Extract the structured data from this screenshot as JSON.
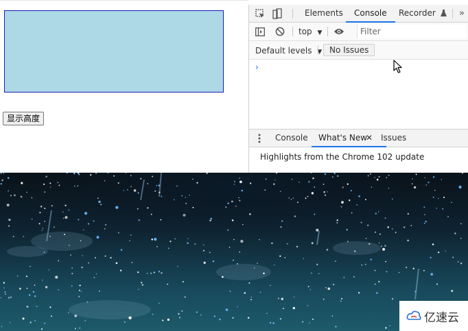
{
  "page": {
    "button_label": "显示高度"
  },
  "devtools": {
    "tabs": [
      "Elements",
      "Console",
      "Recorder"
    ],
    "active_tab": "Console",
    "more_tabs": "»",
    "console_toolbar": {
      "context": "top",
      "filter_placeholder": "Filter"
    },
    "levels": {
      "label": "Default levels",
      "issues_label": "No Issues"
    },
    "prompt": "›",
    "drawer": {
      "tabs": [
        "Console",
        "What's New",
        "Issues"
      ],
      "active_tab": "What's New",
      "close": "✕",
      "highlights_text": "Highlights from the Chrome 102 update"
    }
  },
  "watermark": {
    "text": "亿速云"
  },
  "colors": {
    "accent": "#1a73e8",
    "box_fill": "#add8e6",
    "box_border": "#1a1ab8"
  }
}
